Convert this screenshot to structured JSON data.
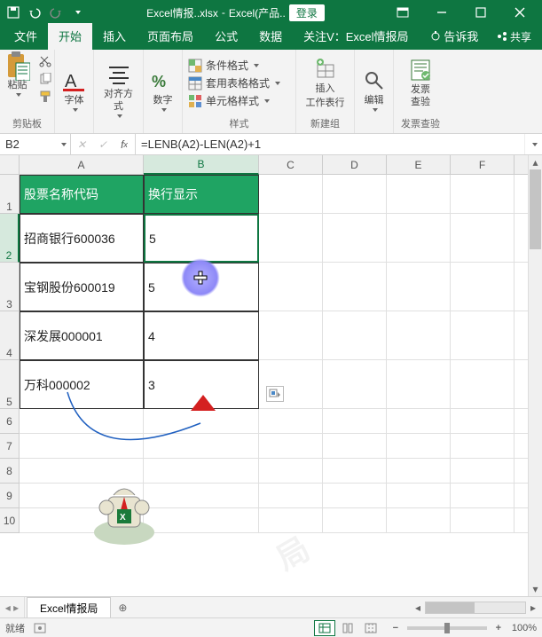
{
  "titlebar": {
    "filename": "Excel情报..xlsx",
    "sep": "-",
    "app": "Excel(产品..",
    "login": "登录"
  },
  "tabs": {
    "file": "文件",
    "home": "开始",
    "insert": "插入",
    "layout": "页面布局",
    "formulas": "公式",
    "data": "数据",
    "attn": "关注V：Excel情报局",
    "tellme": "告诉我",
    "share": "共享"
  },
  "ribbon": {
    "paste": "粘贴",
    "clipboard": "剪贴板",
    "font": "字体",
    "align": "对齐方式",
    "number": "数字",
    "cond_fmt": "条件格式",
    "table_fmt": "套用表格格式",
    "cell_fmt": "单元格样式",
    "styles": "样式",
    "insert_btn": "插入",
    "worksheet_row": "工作表行",
    "newgroup": "新建组",
    "edit": "编辑",
    "invoice": "发票\n查验",
    "invoice_grp": "发票查验"
  },
  "fx": {
    "namebox": "B2",
    "formula": "=LENB(A2)-LEN(A2)+1"
  },
  "cols": [
    "A",
    "B",
    "C",
    "D",
    "E",
    "F"
  ],
  "rows": [
    "1",
    "2",
    "3",
    "4",
    "5",
    "6",
    "7",
    "8",
    "9",
    "10"
  ],
  "table": {
    "h1": "股票名称代码",
    "h2": "换行显示",
    "rows": [
      {
        "a": "招商银行600036",
        "b": "5"
      },
      {
        "a": "宝钢股份600019",
        "b": "5"
      },
      {
        "a": "深发展000001",
        "b": "4"
      },
      {
        "a": "万科000002",
        "b": "3"
      }
    ]
  },
  "watermark": "Excel情报局",
  "watermark2": "局",
  "sheet": {
    "name": "Excel情报局"
  },
  "status": {
    "ready": "就绪",
    "zoom": "100%"
  },
  "chart_data": null
}
